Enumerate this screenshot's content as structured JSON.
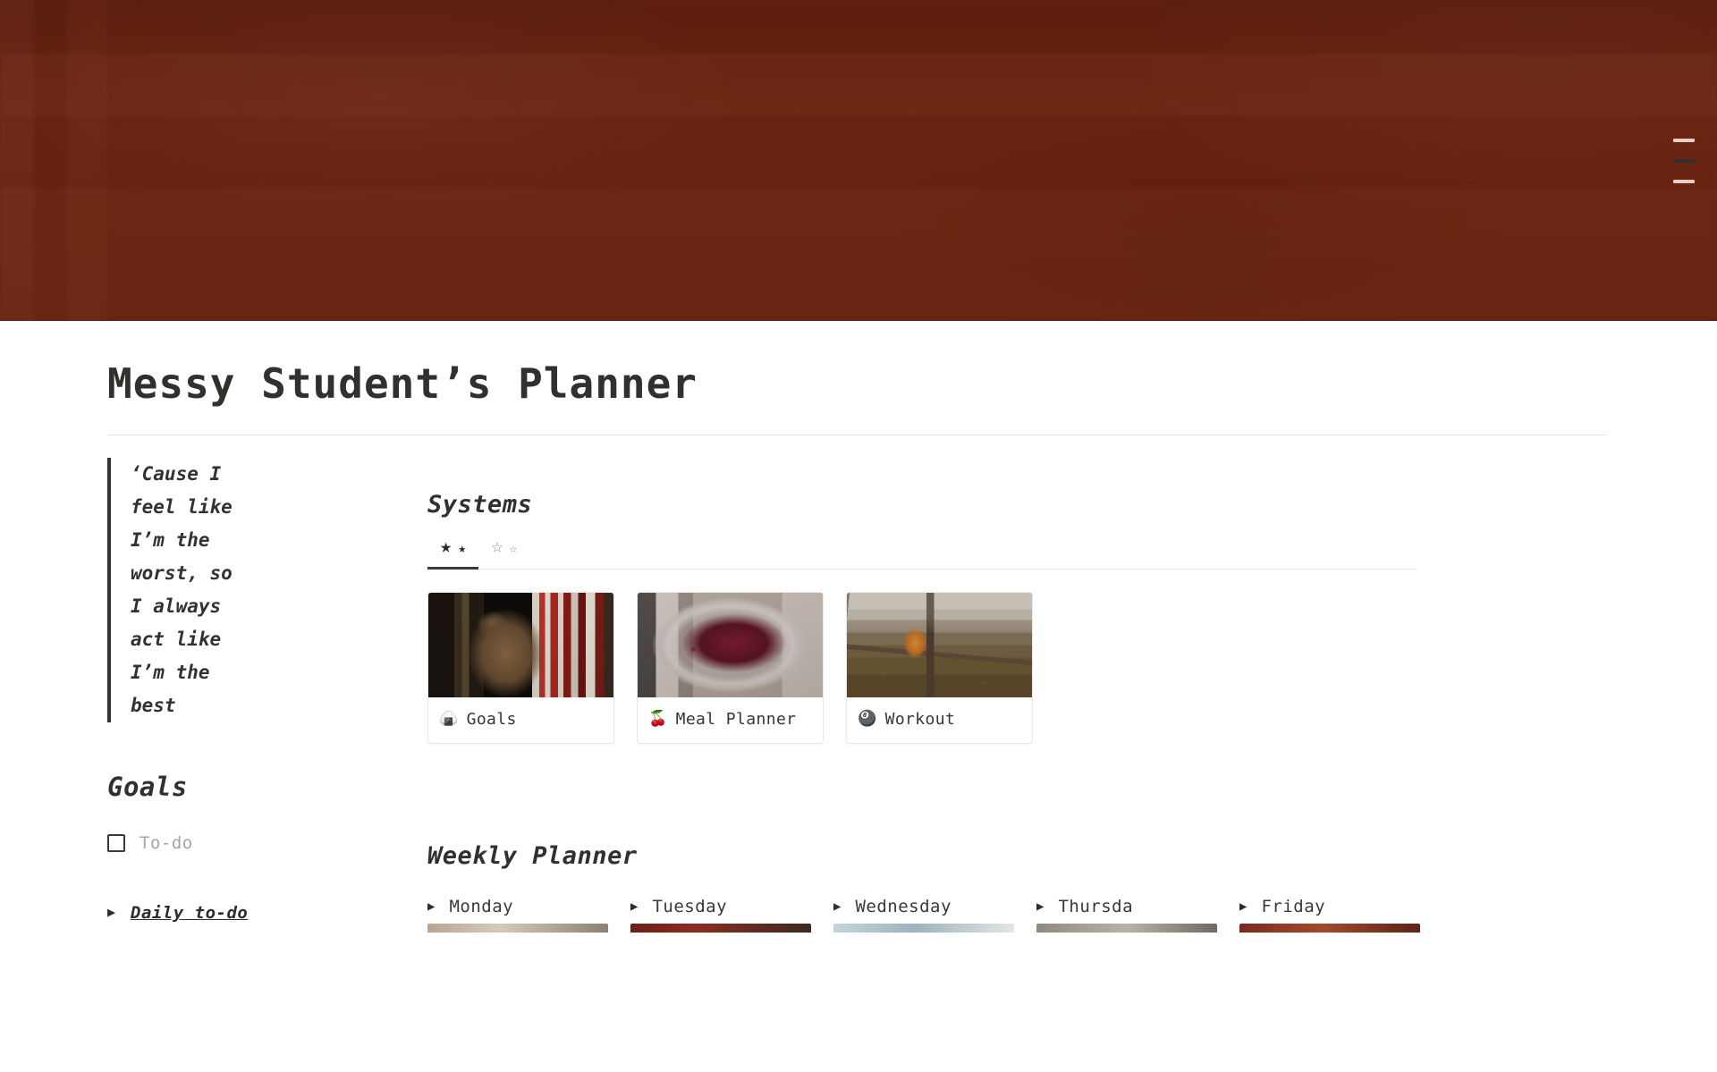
{
  "cover": {
    "background_color": "#6f2511",
    "menu_icon": "hamburger-menu-icon"
  },
  "page_title": "Messy Student’s Planner",
  "sidebar": {
    "quote": "‘Cause I feel like I’m the worst, so I always act like I’m the best",
    "goals_heading": "Goals",
    "todo": {
      "label": "To-do",
      "checked": false
    },
    "daily_toggle": {
      "arrow": "▶",
      "label": "Daily to-do"
    }
  },
  "systems": {
    "heading": "Systems",
    "tabs": [
      {
        "name": "two-star-tab",
        "star_large": "★",
        "star_small": "★",
        "active": true
      },
      {
        "name": "two-star-outline-tab",
        "star_large": "☆",
        "star_small": "☆",
        "active": false
      }
    ],
    "cards": [
      {
        "emoji": "🍙",
        "title": "Goals",
        "image_alt": "tabby-cat-with-books"
      },
      {
        "emoji": "🍒",
        "title": "Meal Planner",
        "image_alt": "pot-of-cherries"
      },
      {
        "emoji": "🎱",
        "title": "Workout",
        "image_alt": "orange-cat-on-fence"
      }
    ]
  },
  "weekly_planner": {
    "heading": "Weekly Planner",
    "days": [
      {
        "arrow": "▶",
        "name": "Monday"
      },
      {
        "arrow": "▶",
        "name": "Tuesday"
      },
      {
        "arrow": "▶",
        "name": "Wednesday"
      },
      {
        "arrow": "▶",
        "name": "Thursda"
      },
      {
        "arrow": "▶",
        "name": "Friday"
      }
    ]
  },
  "colors": {
    "cover": "#6f2511",
    "text": "#32302d",
    "muted": "#a6a6a6",
    "divider": "#e6e6e6"
  }
}
